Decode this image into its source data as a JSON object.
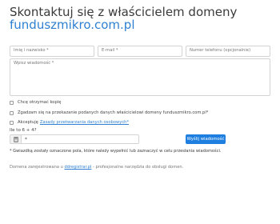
{
  "header": {
    "title": "Skontaktuj się z właścicielem domeny",
    "domain": "funduszmikro.com.pl"
  },
  "form": {
    "name_placeholder": "Imię i nazwisko *",
    "email_placeholder": "E-mail *",
    "phone_placeholder": "Numer telefonu (opcjonalnie)",
    "message_placeholder": "Wpisz wiadomość *",
    "copy_label": "Chcę otrzymać kopię",
    "consent_label": "Zgadzam się na przekazanie podanych danych właścicielowi domeny funduszmikro.com.pl*",
    "accept_label": "Akceptuję",
    "privacy_link": "Zasady przetwarzania danych osobowych*",
    "captcha_question": "Ile to 6 + 4?",
    "captcha_value": "*",
    "send_label": "Wyślij wiadomość",
    "note": "* Gwiazdką zostały oznaczone pola, które należy wypełnić lub zaznaczyć w celu przesłania wiadomości."
  },
  "footer": {
    "prefix": "Domena zarejestrowana u",
    "registrar_link": "ddregistrar.pl",
    "suffix": " - profesjonalne narzędzia do obsługi domen."
  },
  "icons": {
    "captcha": "calculator-icon"
  },
  "colors": {
    "accent": "#2f80d1",
    "button": "#1f7fe0"
  }
}
